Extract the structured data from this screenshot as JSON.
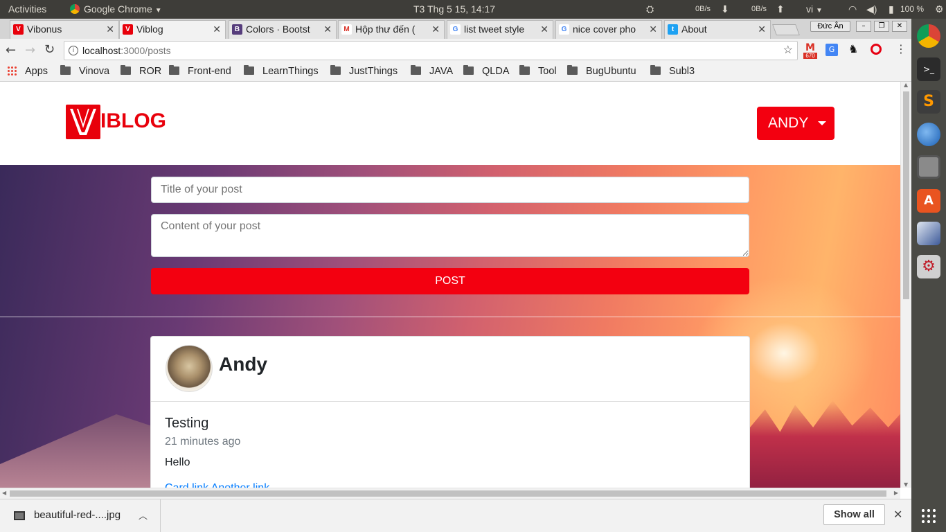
{
  "topbar": {
    "activities": "Activities",
    "app": "Google Chrome",
    "clock": "T3 Thg 5 15, 14:17",
    "net_down": "0B/s",
    "net_up": "0B/s",
    "lang": "vi",
    "battery": "100 %"
  },
  "tabs": [
    {
      "label": "Vibonus",
      "favicon": "V",
      "color": "#e8000b"
    },
    {
      "label": "Viblog",
      "favicon": "V",
      "color": "#e8000b"
    },
    {
      "label": "Colors · Bootst",
      "favicon": "B",
      "color": "#563d7c"
    },
    {
      "label": "Hộp thư đến (",
      "favicon": "M",
      "color": "#d93025"
    },
    {
      "label": "list tweet style",
      "favicon": "G",
      "color": "#4285f4"
    },
    {
      "label": "nice cover pho",
      "favicon": "G",
      "color": "#4285f4"
    },
    {
      "label": "About",
      "favicon": "t",
      "color": "#1da1f2"
    }
  ],
  "window": {
    "profile": "Đức Ân"
  },
  "toolbar": {
    "url_host": "localhost",
    "url_path": ":3000/posts"
  },
  "bookmarks": {
    "apps": "Apps",
    "folders": [
      "Vinova",
      "ROR",
      "Front-end",
      "LearnThings",
      "JustThings",
      "JAVA",
      "QLDA",
      "Tool",
      "BugUbuntu",
      "Subl3"
    ]
  },
  "extensions": {
    "gmail_count": "670"
  },
  "site": {
    "logo_text": "IBLOG",
    "user_button": "ANDY",
    "form": {
      "title_placeholder": "Title of your post",
      "content_placeholder": "Content of your post",
      "submit_label": "POST"
    },
    "post": {
      "author": "Andy",
      "title": "Testing",
      "time": "21 minutes ago",
      "body": "Hello",
      "links": "Card link   Another link"
    }
  },
  "downloads": {
    "file": "beautiful-red-....jpg",
    "show_all": "Show all"
  }
}
